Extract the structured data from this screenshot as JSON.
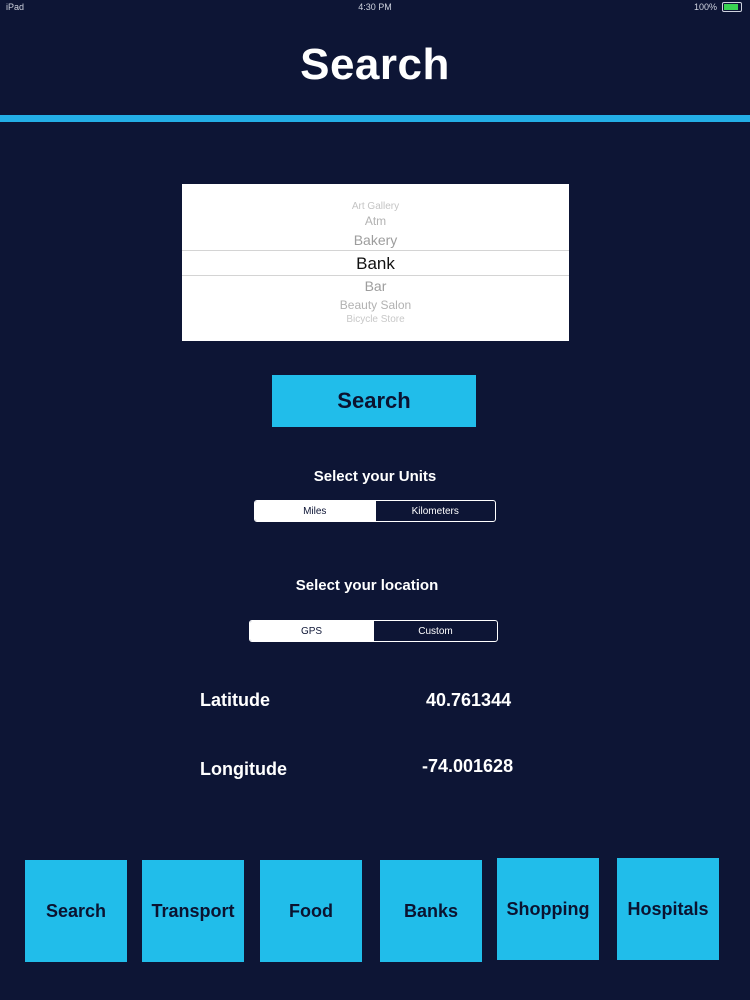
{
  "status_bar": {
    "carrier": "iPad",
    "time": "4:30 PM",
    "battery": "100%"
  },
  "header": {
    "title": "Search"
  },
  "picker": {
    "items": [
      "Art Gallery",
      "Atm",
      "Bakery",
      "Bank",
      "Bar",
      "Beauty Salon",
      "Bicycle Store"
    ],
    "selected": "Bank"
  },
  "search_button": {
    "label": "Search"
  },
  "units": {
    "label": "Select your Units",
    "options": [
      "Miles",
      "Kilometers"
    ],
    "selected": "Miles"
  },
  "location": {
    "label": "Select your location",
    "options": [
      "GPS",
      "Custom"
    ],
    "selected": "GPS"
  },
  "coordinates": {
    "latitude_label": "Latitude",
    "latitude_value": "40.761344",
    "longitude_label": "Longitude",
    "longitude_value": "-74.001628"
  },
  "tabs": [
    "Search",
    "Transport",
    "Food",
    "Banks",
    "Shopping",
    "Hospitals"
  ],
  "colors": {
    "background": "#0d1535",
    "accent": "#21bdea",
    "rule": "#23aee6"
  }
}
